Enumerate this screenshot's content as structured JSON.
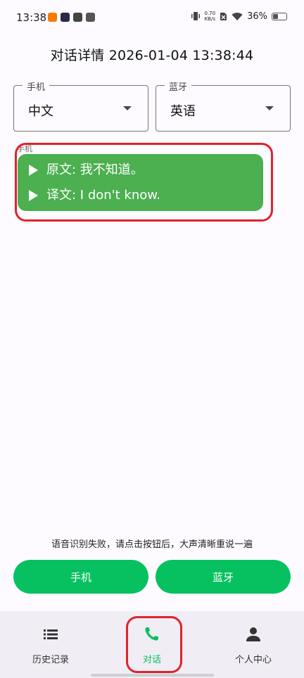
{
  "status": {
    "time": "13:38",
    "net_speed_value": "0.70",
    "net_speed_unit": "KB/s",
    "battery": "36%",
    "battery_level": 0.36
  },
  "page": {
    "title": "对话详情 2026-01-04 13:38:44"
  },
  "dropdowns": {
    "left": {
      "label": "手机",
      "value": "中文"
    },
    "right": {
      "label": "蓝牙",
      "value": "英语"
    }
  },
  "message": {
    "sender": "手机",
    "original": "原文: 我不知道。",
    "translated": "译文: I don't know."
  },
  "hint": "语音识别失败，请点击按钮后，大声清晰重说一遍",
  "buttons": {
    "phone": "手机",
    "bluetooth": "蓝牙"
  },
  "nav": {
    "items": [
      {
        "label": "历史记录",
        "icon": "list-icon"
      },
      {
        "label": "对话",
        "icon": "phone-icon"
      },
      {
        "label": "个人中心",
        "icon": "person-icon"
      }
    ],
    "active_index": 1
  },
  "colors": {
    "accent": "#07c160",
    "bubble": "#4caf50",
    "annotation": "#e0222b"
  }
}
